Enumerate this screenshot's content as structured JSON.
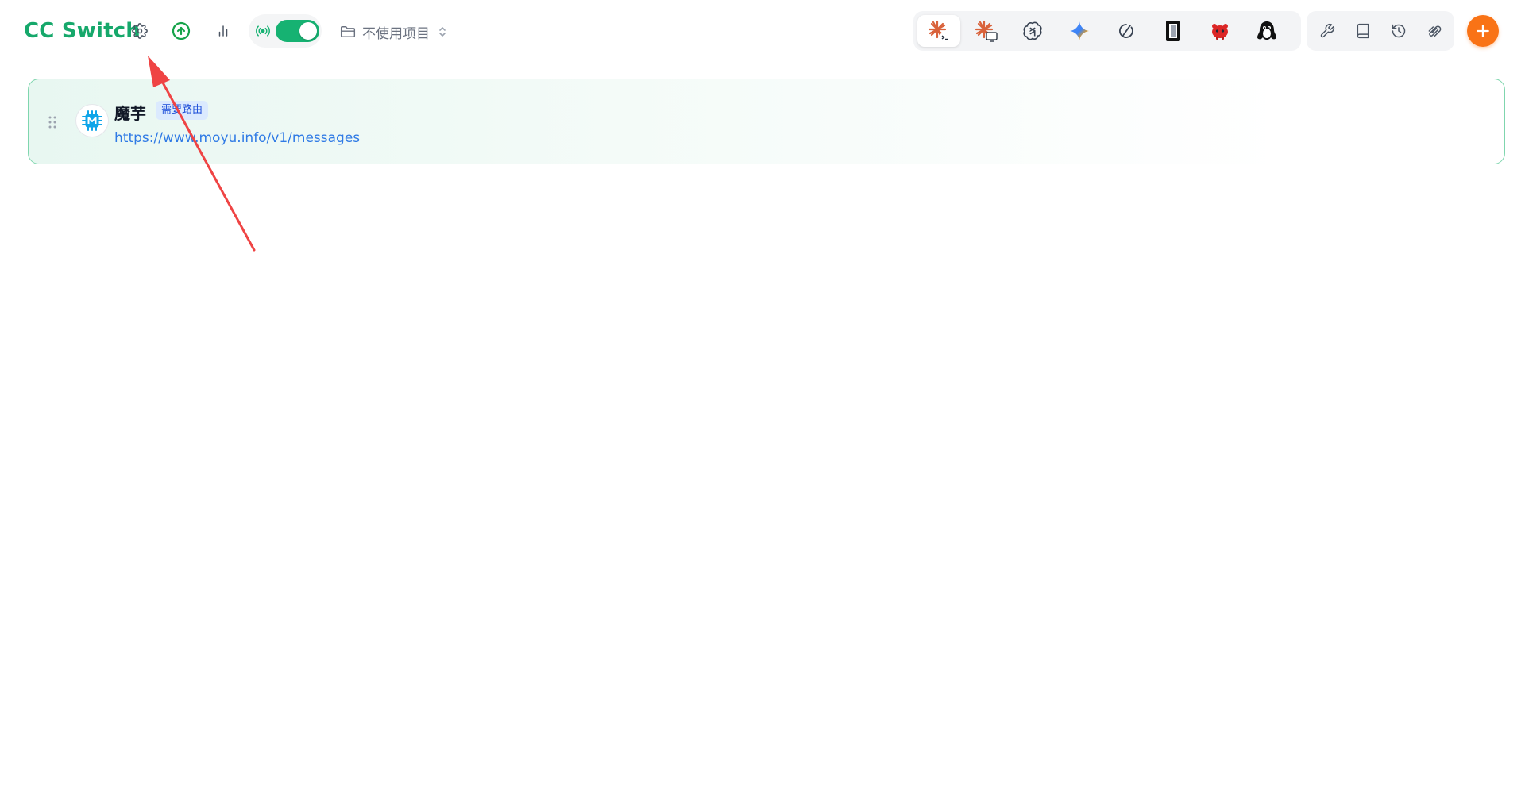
{
  "header": {
    "app_title": "CC Switch",
    "project_selector": {
      "value": "不使用项目",
      "icon": "folder-icon"
    },
    "proxy_toggle": {
      "enabled": true,
      "icon": "radio-signal-icon"
    },
    "icons": [
      "settings-gear-icon",
      "update-arrow-up-icon",
      "usage-stats-icon"
    ]
  },
  "app_switcher": {
    "items": [
      {
        "id": "claude-code",
        "icon": "claude-code-icon",
        "active": true
      },
      {
        "id": "claude-desktop",
        "icon": "claude-desktop-icon",
        "active": false
      },
      {
        "id": "openai-codex",
        "icon": "openai-icon",
        "active": false
      },
      {
        "id": "gemini",
        "icon": "gemini-icon",
        "active": false
      },
      {
        "id": "opencode",
        "icon": "opencode-icon",
        "active": false
      },
      {
        "id": "terminal-app",
        "icon": "black-app-icon",
        "active": false
      },
      {
        "id": "red-app",
        "icon": "red-creature-icon",
        "active": false
      },
      {
        "id": "penguin-app",
        "icon": "penguin-icon",
        "active": false
      }
    ]
  },
  "tools": {
    "items": [
      "wrench-icon",
      "book-icon",
      "history-icon",
      "link-chain-icon"
    ]
  },
  "add_button": {
    "icon": "plus-icon",
    "color": "#f97316"
  },
  "providers": [
    {
      "name": "魔芋",
      "badge": "需要路由",
      "url": "https://www.moyu.info/v1/messages",
      "icon": "chip-m-icon",
      "active": true
    }
  ],
  "colors": {
    "brand": "#16a86b",
    "toggle_on": "#16b272",
    "url": "#2f7ae5",
    "annotation": "#ef4444"
  }
}
